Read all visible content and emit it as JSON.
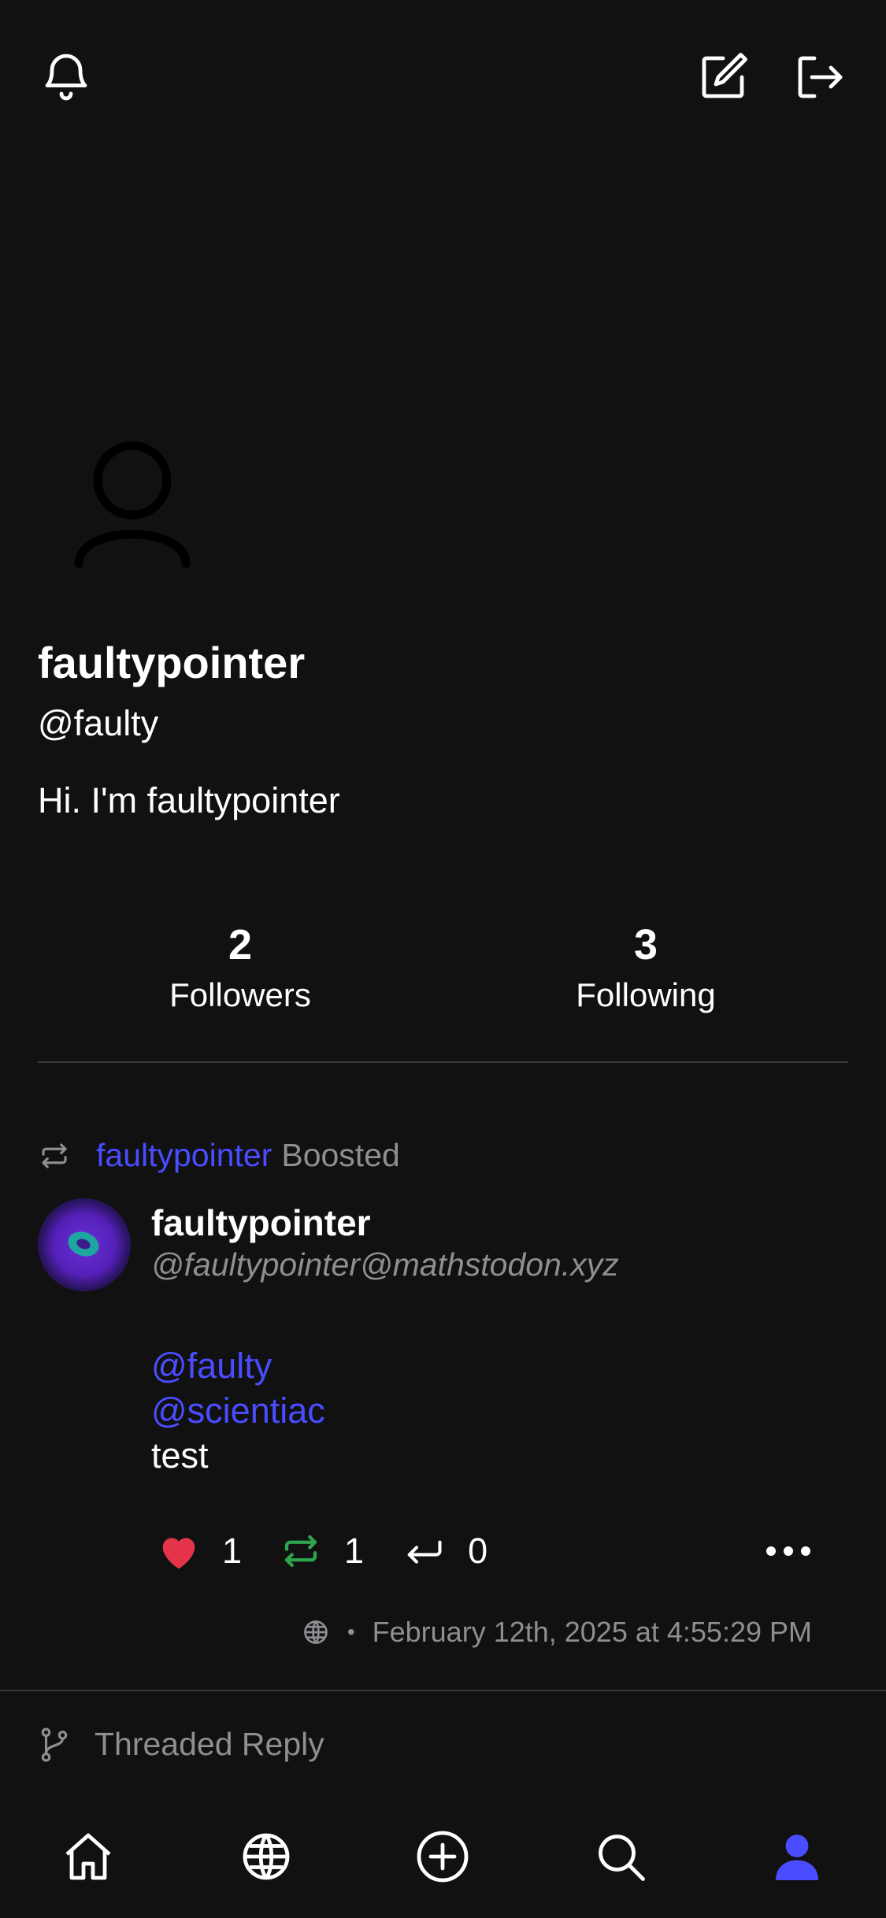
{
  "header": {
    "icons": [
      "bell-icon",
      "compose-icon",
      "logout-icon"
    ]
  },
  "profile": {
    "display_name": "faultypointer",
    "handle": "@faulty",
    "bio": "Hi. I'm faultypointer",
    "followers_count": "2",
    "followers_label": "Followers",
    "following_count": "3",
    "following_label": "Following"
  },
  "post": {
    "boosted_by": "faultypointer",
    "boosted_label": "Boosted",
    "author_name": "faultypointer",
    "author_acct": "@faultypointer@mathstodon.xyz",
    "mentions": [
      "@faulty",
      "@scientiac"
    ],
    "text": "test",
    "likes": "1",
    "boosts": "1",
    "replies": "0",
    "timestamp": "February 12th, 2025 at 4:55:29 PM",
    "visibility_icon": "globe-icon"
  },
  "threaded_reply_label": "Threaded Reply",
  "bottom_nav": {
    "items": [
      "home-icon",
      "globe-icon",
      "plus-circle-icon",
      "search-icon",
      "profile-icon"
    ],
    "active": "profile-icon"
  },
  "colors": {
    "background": "#111112",
    "accent": "#4a4dff",
    "like": "#e5344a",
    "boost": "#2ea44f",
    "muted": "#8e8e93"
  }
}
